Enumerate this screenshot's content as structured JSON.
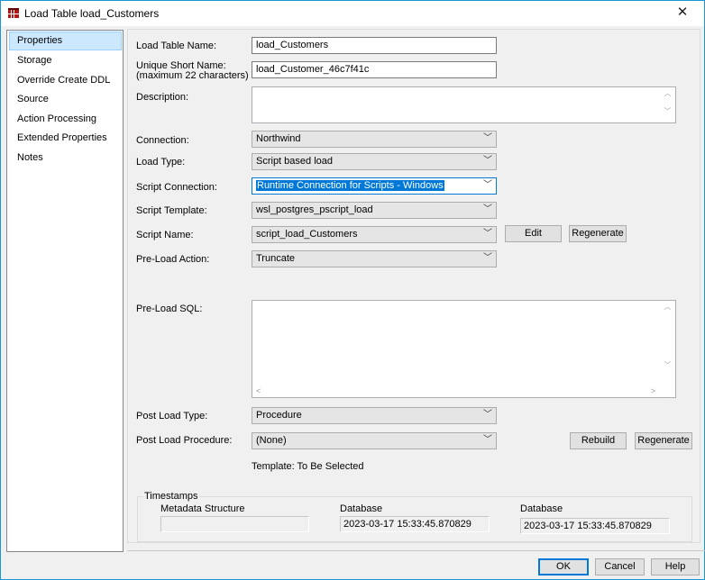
{
  "window": {
    "title": "Load Table load_Customers",
    "close": "✕"
  },
  "sidebar": {
    "items": [
      {
        "label": "Properties"
      },
      {
        "label": "Storage"
      },
      {
        "label": "Override Create DDL"
      },
      {
        "label": "Source"
      },
      {
        "label": "Action Processing"
      },
      {
        "label": "Extended Properties"
      },
      {
        "label": "Notes"
      }
    ]
  },
  "form": {
    "load_table_name": {
      "label": "Load Table Name:",
      "value": "load_Customers"
    },
    "unique_short_name": {
      "label": "Unique Short Name:",
      "sublabel": "(maximum 22 characters)",
      "value": "load_Customer_46c7f41c"
    },
    "description": {
      "label": "Description:",
      "value": ""
    },
    "connection": {
      "label": "Connection:",
      "value": "Northwind"
    },
    "load_type": {
      "label": "Load Type:",
      "value": "Script based load"
    },
    "script_connection": {
      "label": "Script Connection:",
      "value": "Runtime Connection for Scripts - Windows"
    },
    "script_template": {
      "label": "Script Template:",
      "value": "wsl_postgres_pscript_load"
    },
    "script_name": {
      "label": "Script Name:",
      "value": "script_load_Customers",
      "edit": "Edit",
      "regenerate": "Regenerate"
    },
    "pre_load_action": {
      "label": "Pre-Load Action:",
      "value": "Truncate"
    },
    "pre_load_sql": {
      "label": "Pre-Load SQL:",
      "value": ""
    },
    "post_load_type": {
      "label": "Post Load Type:",
      "value": "Procedure"
    },
    "post_load_procedure": {
      "label": "Post Load Procedure:",
      "value": "(None)",
      "rebuild": "Rebuild",
      "regenerate": "Regenerate"
    },
    "template_text": "Template: To Be Selected"
  },
  "timestamps": {
    "title": "Timestamps",
    "metadata": {
      "label": "Metadata Structure",
      "value": ""
    },
    "database1": {
      "label": "Database",
      "value": "2023-03-17 15:33:45.870829"
    },
    "database2": {
      "label": "Database",
      "value": "2023-03-17 15:33:45.870829"
    }
  },
  "buttons": {
    "ok": "OK",
    "cancel": "Cancel",
    "help": "Help"
  },
  "colors": {
    "accent": "#0078d7",
    "selected": "#cce8ff",
    "frame": "#1c97d6"
  }
}
